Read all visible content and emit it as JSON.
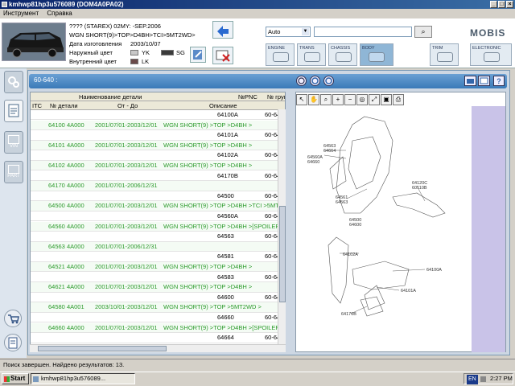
{
  "window": {
    "title": "kmhwp81hp3u576089 (DOM4A0PA02)"
  },
  "menu": [
    "Инструмент",
    "Справка"
  ],
  "vehicle": {
    "line1": "???? (STAREX) 02MY: -SEP.2006",
    "line2": "WGN SHORT(9)>TOP>D4BH>TCI>5MT2WD>",
    "date_label": "Дата изготовления",
    "date_value": "2003/10/07",
    "ext_color_label": "Наружный цвет",
    "ext_color_code": "YK",
    "ext_color_code2": "SG",
    "int_color_label": "Внутренний цвет",
    "int_color_code": "LK",
    "colors": {
      "yk": "#c8c8c8",
      "sg": "#3a3a3a",
      "lk": "#6a4a4a"
    }
  },
  "search": {
    "category": "Auto",
    "value": ""
  },
  "logo": "MOBIS",
  "categories": [
    {
      "label": "ENGINE",
      "active": false
    },
    {
      "label": "TRANS",
      "active": false
    },
    {
      "label": "CHASSIS",
      "active": false
    },
    {
      "label": "BODY",
      "active": true
    },
    {
      "label": "TRIM",
      "active": false
    },
    {
      "label": "ELECTRONIC",
      "active": false
    }
  ],
  "sidebar": [
    {
      "label": "",
      "icon": "settings-icon"
    },
    {
      "label": "",
      "icon": "document-icon"
    },
    {
      "label": "VIN",
      "icon": "vin-icon"
    },
    {
      "label": "PART",
      "icon": "part-icon"
    }
  ],
  "panel": {
    "title": "60-640 :"
  },
  "table": {
    "group_header": "Наименование детали",
    "pnc_header": "№PNC",
    "grp_header": "№ груп",
    "columns": [
      "ITC",
      "№ детали",
      "От - До",
      "Описание"
    ],
    "rows": [
      {
        "type": "pnc",
        "pnc": "64100A",
        "grp": "60-640"
      },
      {
        "type": "data",
        "part": "64100 4A000",
        "range": "2001/07/01-2003/12/01",
        "desc": "WGN SHORT(9) >TOP >D4BH >"
      },
      {
        "type": "pnc",
        "pnc": "64101A",
        "grp": "60-640"
      },
      {
        "type": "data",
        "part": "64101 4A000",
        "range": "2001/07/01-2003/12/01",
        "desc": "WGN SHORT(9) >TOP >D4BH >"
      },
      {
        "type": "pnc",
        "pnc": "64102A",
        "grp": "60-640"
      },
      {
        "type": "data",
        "part": "64102 4A000",
        "range": "2001/07/01-2003/12/01",
        "desc": "WGN SHORT(9) >TOP >D4BH >"
      },
      {
        "type": "pnc",
        "pnc": "64170B",
        "grp": "60-640"
      },
      {
        "type": "data",
        "part": "64170 4A000",
        "range": "2001/07/01-2006/12/31",
        "desc": ""
      },
      {
        "type": "pnc",
        "pnc": "64500",
        "grp": "60-640"
      },
      {
        "type": "data",
        "part": "64500 4A000",
        "range": "2001/07/01-2003/12/01",
        "desc": "WGN SHORT(9) >TOP >D4BH >TCI >5MT2V"
      },
      {
        "type": "pnc",
        "pnc": "64560A",
        "grp": "60-640"
      },
      {
        "type": "data",
        "part": "64560 4A000",
        "range": "2001/07/01-2003/12/01",
        "desc": "WGN SHORT(9) >TOP >D4BH >[SPOILER-L"
      },
      {
        "type": "pnc",
        "pnc": "64563",
        "grp": "60-640"
      },
      {
        "type": "data",
        "part": "64563 4A000",
        "range": "2001/07/01-2006/12/31",
        "desc": ""
      },
      {
        "type": "pnc",
        "pnc": "64581",
        "grp": "60-640"
      },
      {
        "type": "data",
        "part": "64521 4A000",
        "range": "2001/07/01-2003/12/01",
        "desc": "WGN SHORT(9) >TOP >D4BH >"
      },
      {
        "type": "pnc",
        "pnc": "64583",
        "grp": "60-640"
      },
      {
        "type": "data",
        "part": "64621 4A000",
        "range": "2001/07/01-2003/12/01",
        "desc": "WGN SHORT(9) >TOP >D4BH >"
      },
      {
        "type": "pnc",
        "pnc": "64600",
        "grp": "60-640"
      },
      {
        "type": "data",
        "part": "64580 4A001",
        "range": "2003/10/01-2003/12/01",
        "desc": "WGN SHORT(9) >TOP >5MT2WD >"
      },
      {
        "type": "pnc",
        "pnc": "64660",
        "grp": "60-640"
      },
      {
        "type": "data",
        "part": "64660 4A000",
        "range": "2001/07/01-2003/12/01",
        "desc": "WGN SHORT(9) >TOP >D4BH >[SPOILER-L"
      },
      {
        "type": "pnc",
        "pnc": "64664",
        "grp": "60-640"
      }
    ]
  },
  "diagram_labels": [
    "64563",
    "64664",
    "64560A",
    "64660",
    "64561",
    "64563",
    "64500",
    "64600",
    "64120C",
    "60110B",
    "64102A",
    "64100A",
    "64101A",
    "64170B"
  ],
  "status": "Поиск завершен. Найдено результатов: 13.",
  "taskbar": {
    "start": "Start",
    "item": "kmhwp81hp3u576089...",
    "lang": "EN",
    "clock": "2:27 PM"
  }
}
